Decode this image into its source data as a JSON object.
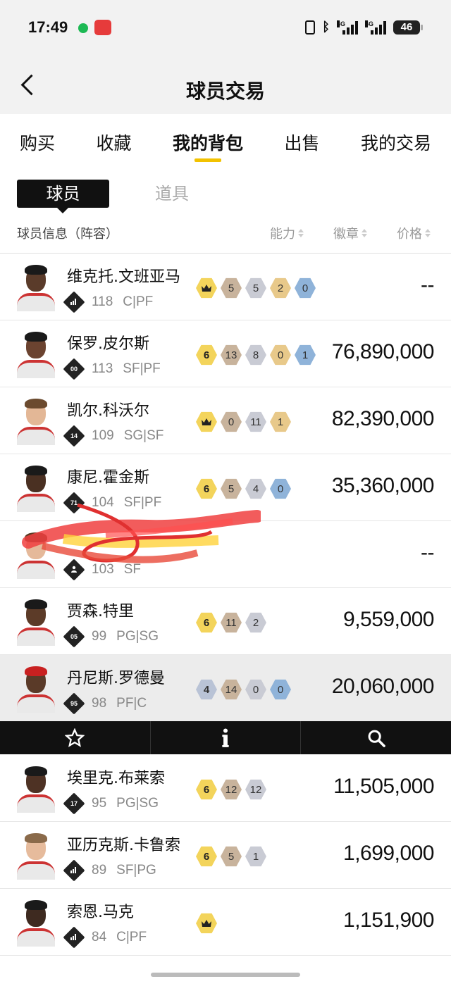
{
  "status": {
    "time": "17:49",
    "net1": "4G",
    "net2": "4G",
    "battery": "46"
  },
  "header": {
    "title": "球员交易"
  },
  "tabs": [
    {
      "label": "购买",
      "active": false
    },
    {
      "label": "收藏",
      "active": false
    },
    {
      "label": "我的背包",
      "active": true
    },
    {
      "label": "出售",
      "active": false
    },
    {
      "label": "我的交易",
      "active": false
    }
  ],
  "subtabs": {
    "player": "球员",
    "item": "道具"
  },
  "columns": {
    "info": "球员信息（阵容）",
    "ability": "能力",
    "badges": "徽章",
    "price": "价格"
  },
  "players": [
    {
      "name": "维克托.文班亚马",
      "tendency": "",
      "tendency_icon": "bars-icon",
      "rating": "118",
      "positions": "C|PF",
      "level_icon": "crown-icon",
      "badges": [
        "5",
        "5",
        "2",
        "0"
      ],
      "price": "--",
      "skin": "#5a3b2a",
      "hair": "#1a1a1a"
    },
    {
      "name": "保罗.皮尔斯",
      "tendency": "00",
      "rating": "113",
      "positions": "SF|PF",
      "level": "6",
      "badges": [
        "13",
        "8",
        "0",
        "1"
      ],
      "price": "76,890,000",
      "skin": "#6b4330",
      "hair": "#1a1a1a"
    },
    {
      "name": "凯尔.科沃尔",
      "tendency": "14",
      "rating": "109",
      "positions": "SG|SF",
      "level_icon": "crown-icon",
      "badges": [
        "0",
        "11",
        "1"
      ],
      "price": "82,390,000",
      "skin": "#e3b796",
      "hair": "#6b4a2e"
    },
    {
      "name": "康尼.霍金斯",
      "tendency": "71",
      "rating": "104",
      "positions": "SF|PF",
      "level": "6",
      "badges": [
        "5",
        "4",
        "0"
      ],
      "price": "35,360,000",
      "skin": "#4a3022",
      "hair": "#1a1a1a"
    },
    {
      "name": "",
      "tendency": "",
      "tendency_icon": "person-icon",
      "rating": "103",
      "positions": "SF",
      "badges": [],
      "price": "--",
      "skin": "#e5b99a",
      "hair": "#5a3a22"
    },
    {
      "name": "贾森.特里",
      "tendency": "05",
      "rating": "99",
      "positions": "PG|SG",
      "level": "6",
      "badges": [
        "11",
        "2"
      ],
      "price": "9,559,000",
      "skin": "#5c3b28",
      "hair": "#1a1a1a"
    },
    {
      "name": "丹尼斯.罗德曼",
      "tendency": "95",
      "rating": "98",
      "positions": "PF|C",
      "level": "4",
      "badges": [
        "14",
        "0",
        "0"
      ],
      "price": "20,060,000",
      "skin": "#5a3a28",
      "hair": "#c82020"
    },
    {
      "name": "埃里克.布莱索",
      "tendency": "17",
      "rating": "95",
      "positions": "PG|SG",
      "level": "6",
      "badges": [
        "12",
        "12"
      ],
      "price": "11,505,000",
      "skin": "#4e3224",
      "hair": "#1a1a1a"
    },
    {
      "name": "亚历克斯.卡鲁索",
      "tendency": "",
      "tendency_icon": "bars-icon",
      "rating": "89",
      "positions": "SF|PG",
      "level": "6",
      "badges": [
        "5",
        "1"
      ],
      "price": "1,699,000",
      "skin": "#e6bb9c",
      "hair": "#8a6a4a"
    },
    {
      "name": "索恩.马克",
      "tendency": "",
      "tendency_icon": "bars-icon",
      "rating": "84",
      "positions": "C|PF",
      "level_icon": "crown-icon",
      "badges": [],
      "price": "1,151,900",
      "skin": "#3e2a20",
      "hair": "#1a1a1a"
    }
  ],
  "toolbar": [
    {
      "icon": "star-icon",
      "glyph": "☆"
    },
    {
      "icon": "info-icon",
      "glyph": "i"
    },
    {
      "icon": "search-icon",
      "glyph": "⌕"
    }
  ]
}
